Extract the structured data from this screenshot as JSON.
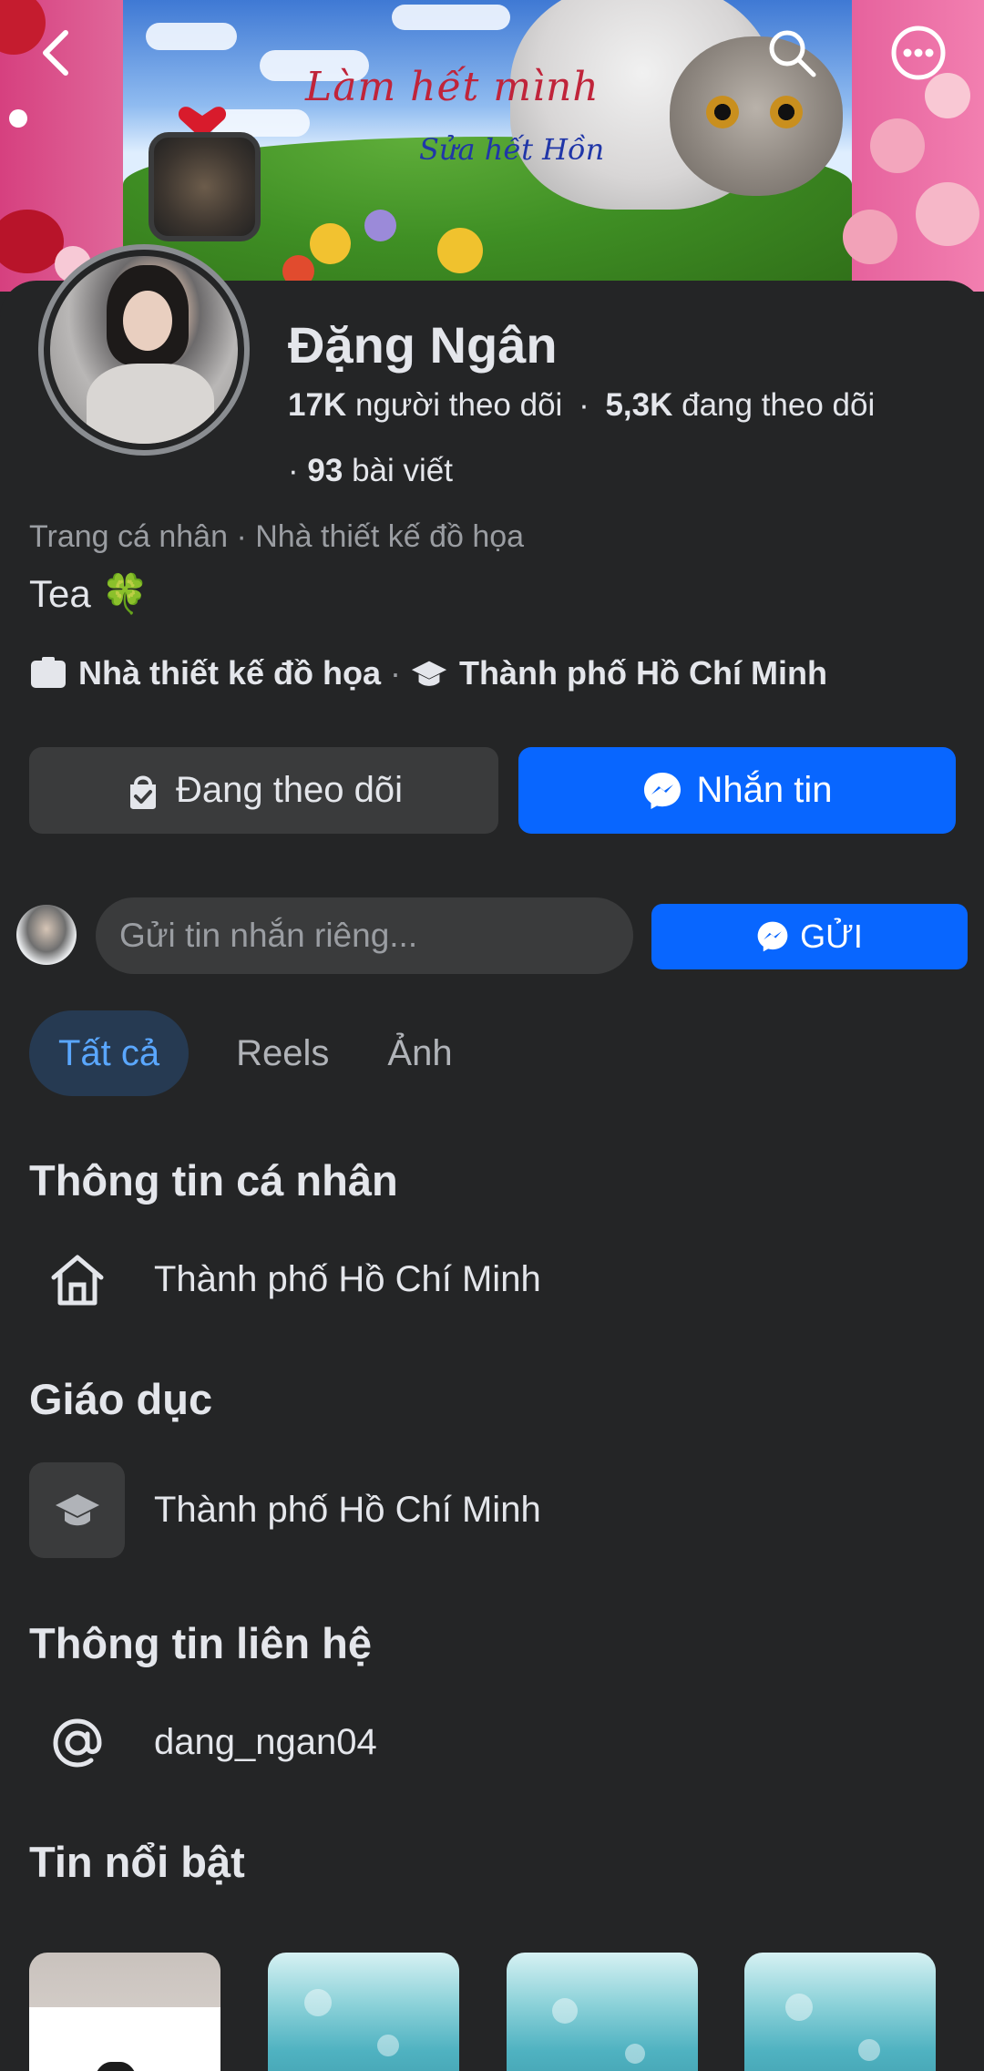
{
  "cover": {
    "title": "Làm hết mình",
    "subtitle": "Sửa hết Hồn"
  },
  "profile": {
    "name": "Đặng Ngân",
    "followers_count": "17K",
    "followers_label": "người theo dõi",
    "following_count": "5,3K",
    "following_label": "đang theo dõi",
    "posts_count": "93",
    "posts_label": "bài viết",
    "subtitle": "Trang cá nhân · Nhà thiết kế đồ họa",
    "bio": "Tea 🍀",
    "detail_work": "Nhà thiết kế đồ họa",
    "detail_school": "Thành phố Hồ Chí Minh"
  },
  "actions": {
    "following_label": "Đang theo dõi",
    "message_label": "Nhắn tin"
  },
  "compose": {
    "placeholder": "Gửi tin nhắn riêng...",
    "send_label": "GỬI"
  },
  "tabs": [
    {
      "label": "Tất cả",
      "active": true
    },
    {
      "label": "Reels",
      "active": false
    },
    {
      "label": "Ảnh",
      "active": false
    }
  ],
  "sections": {
    "personal_info": {
      "title": "Thông tin cá nhân",
      "location": "Thành phố Hồ Chí Minh"
    },
    "education": {
      "title": "Giáo dục",
      "school": "Thành phố Hồ Chí Minh"
    },
    "contact": {
      "title": "Thông tin liên hệ",
      "handle": "dang_ngan04"
    },
    "highlights": {
      "title": "Tin nổi bật"
    }
  },
  "icons": {
    "back": "chevron-left-icon",
    "search": "search-icon",
    "more": "more-icon",
    "home": "home-icon",
    "education": "graduation-cap-icon",
    "at": "at-sign-icon",
    "messenger": "messenger-icon",
    "following": "following-check-icon",
    "work": "briefcase-icon"
  },
  "colors": {
    "background": "#242526",
    "accent": "#0866ff",
    "tab_active_bg": "#263a52",
    "tab_active_text": "#5aa7ff"
  }
}
